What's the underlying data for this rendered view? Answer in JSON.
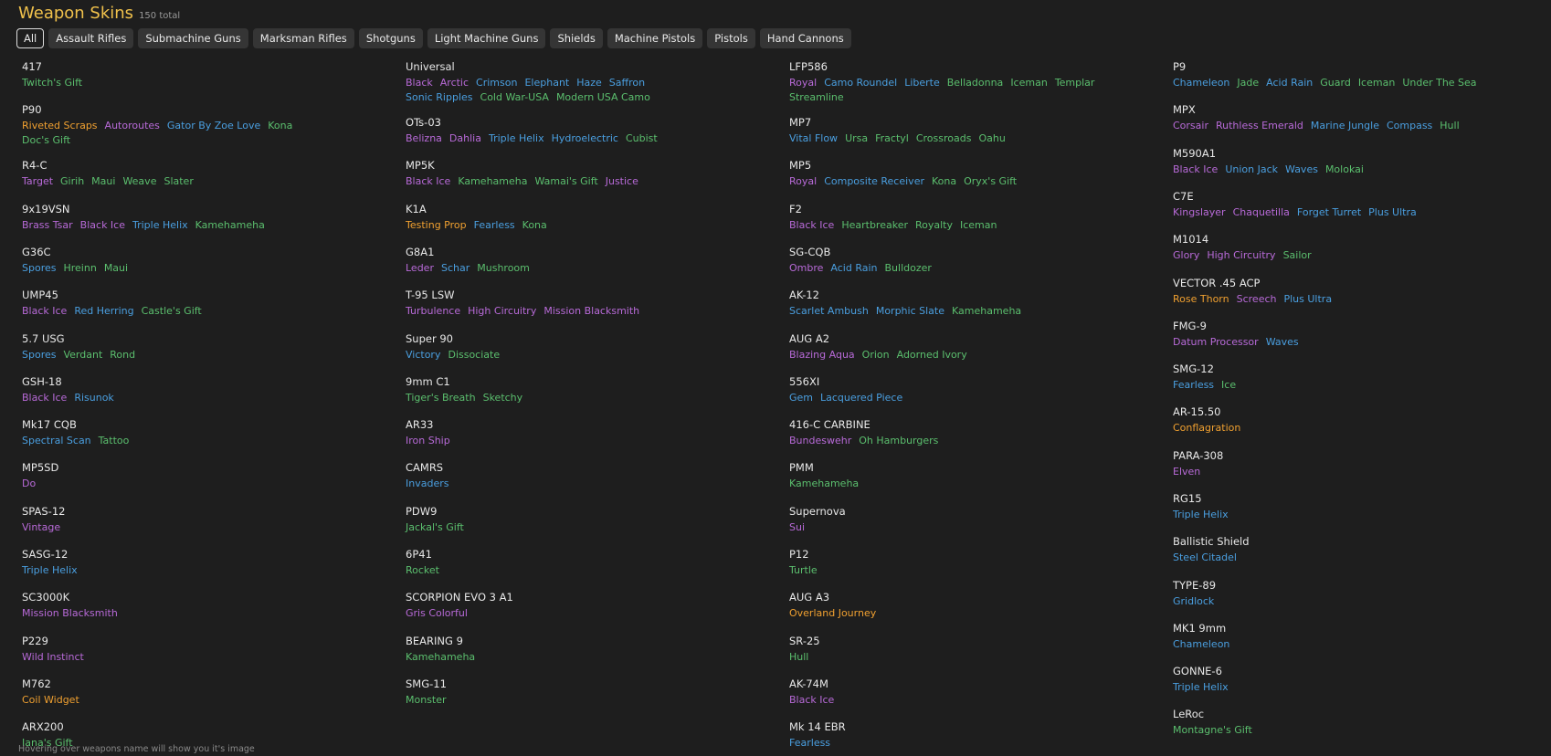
{
  "header": {
    "title": "Weapon Skins",
    "total": "150 total"
  },
  "filters": [
    "All",
    "Assault Rifles",
    "Submachine Guns",
    "Marksman Rifles",
    "Shotguns",
    "Light Machine Guns",
    "Shields",
    "Machine Pistols",
    "Pistols",
    "Hand Cannons"
  ],
  "colors": {
    "green": "#5bbf6e",
    "purple": "#b86ad8",
    "blue": "#4a9fe0",
    "orange": "#f0a030",
    "title": "#f0c14b"
  },
  "columns": [
    [
      {
        "name": "417",
        "skins": [
          {
            "n": "Twitch's Gift",
            "c": "green"
          }
        ]
      },
      {
        "name": "P90",
        "skins": [
          {
            "n": "Riveted Scraps",
            "c": "orange"
          },
          {
            "n": "Autoroutes",
            "c": "purple"
          },
          {
            "n": "Gator By Zoe Love",
            "c": "blue"
          },
          {
            "n": "Kona",
            "c": "green"
          },
          {
            "n": "Doc's Gift",
            "c": "green"
          }
        ]
      },
      {
        "name": "R4-C",
        "skins": [
          {
            "n": "Target",
            "c": "purple"
          },
          {
            "n": "Girih",
            "c": "green"
          },
          {
            "n": "Maui",
            "c": "green"
          },
          {
            "n": "Weave",
            "c": "green"
          },
          {
            "n": "Slater",
            "c": "green"
          }
        ]
      },
      {
        "name": "9x19VSN",
        "skins": [
          {
            "n": "Brass Tsar",
            "c": "purple"
          },
          {
            "n": "Black Ice",
            "c": "purple"
          },
          {
            "n": "Triple Helix",
            "c": "blue"
          },
          {
            "n": "Kamehameha",
            "c": "green"
          }
        ]
      },
      {
        "name": "G36C",
        "skins": [
          {
            "n": "Spores",
            "c": "blue"
          },
          {
            "n": "Hreinn",
            "c": "green"
          },
          {
            "n": "Maui",
            "c": "green"
          }
        ]
      },
      {
        "name": "UMP45",
        "skins": [
          {
            "n": "Black Ice",
            "c": "purple"
          },
          {
            "n": "Red Herring",
            "c": "blue"
          },
          {
            "n": "Castle's Gift",
            "c": "green"
          }
        ]
      },
      {
        "name": "5.7 USG",
        "skins": [
          {
            "n": "Spores",
            "c": "blue"
          },
          {
            "n": "Verdant",
            "c": "green"
          },
          {
            "n": "Rond",
            "c": "green"
          }
        ]
      },
      {
        "name": "GSH-18",
        "skins": [
          {
            "n": "Black Ice",
            "c": "purple"
          },
          {
            "n": "Risunok",
            "c": "blue"
          }
        ]
      },
      {
        "name": "Mk17 CQB",
        "skins": [
          {
            "n": "Spectral Scan",
            "c": "blue"
          },
          {
            "n": "Tattoo",
            "c": "green"
          }
        ]
      },
      {
        "name": "MP5SD",
        "skins": [
          {
            "n": "Do",
            "c": "purple"
          }
        ]
      },
      {
        "name": "SPAS-12",
        "skins": [
          {
            "n": "Vintage",
            "c": "purple"
          }
        ]
      },
      {
        "name": "SASG-12",
        "skins": [
          {
            "n": "Triple Helix",
            "c": "blue"
          }
        ]
      },
      {
        "name": "SC3000K",
        "skins": [
          {
            "n": "Mission Blacksmith",
            "c": "purple"
          }
        ]
      },
      {
        "name": "P229",
        "skins": [
          {
            "n": "Wild Instinct",
            "c": "purple"
          }
        ]
      },
      {
        "name": "M762",
        "skins": [
          {
            "n": "Coil Widget",
            "c": "orange"
          }
        ]
      },
      {
        "name": "ARX200",
        "skins": [
          {
            "n": "Iana's Gift",
            "c": "green"
          }
        ]
      }
    ],
    [
      {
        "name": "Universal",
        "skins": [
          {
            "n": "Black",
            "c": "purple"
          },
          {
            "n": "Arctic",
            "c": "purple"
          },
          {
            "n": "Crimson",
            "c": "blue"
          },
          {
            "n": "Elephant",
            "c": "blue"
          },
          {
            "n": "Haze",
            "c": "blue"
          },
          {
            "n": "Saffron",
            "c": "blue"
          },
          {
            "n": "Sonic Ripples",
            "c": "blue"
          },
          {
            "n": "Cold War-USA",
            "c": "green"
          },
          {
            "n": "Modern USA Camo",
            "c": "green"
          }
        ]
      },
      {
        "name": "OTs-03",
        "skins": [
          {
            "n": "Belizna",
            "c": "purple"
          },
          {
            "n": "Dahlia",
            "c": "purple"
          },
          {
            "n": "Triple Helix",
            "c": "blue"
          },
          {
            "n": "Hydroelectric",
            "c": "blue"
          },
          {
            "n": "Cubist",
            "c": "green"
          }
        ]
      },
      {
        "name": "MP5K",
        "skins": [
          {
            "n": "Black Ice",
            "c": "purple"
          },
          {
            "n": "Kamehameha",
            "c": "green"
          },
          {
            "n": "Wamai's Gift",
            "c": "green"
          },
          {
            "n": "Justice",
            "c": "purple"
          }
        ]
      },
      {
        "name": "K1A",
        "skins": [
          {
            "n": "Testing Prop",
            "c": "orange"
          },
          {
            "n": "Fearless",
            "c": "blue"
          },
          {
            "n": "Kona",
            "c": "green"
          }
        ]
      },
      {
        "name": "G8A1",
        "skins": [
          {
            "n": "Leder",
            "c": "purple"
          },
          {
            "n": "Schar",
            "c": "blue"
          },
          {
            "n": "Mushroom",
            "c": "green"
          }
        ]
      },
      {
        "name": "T-95 LSW",
        "skins": [
          {
            "n": "Turbulence",
            "c": "purple"
          },
          {
            "n": "High Circuitry",
            "c": "purple"
          },
          {
            "n": "Mission Blacksmith",
            "c": "purple"
          }
        ]
      },
      {
        "name": "Super 90",
        "skins": [
          {
            "n": "Victory",
            "c": "blue"
          },
          {
            "n": "Dissociate",
            "c": "green"
          }
        ]
      },
      {
        "name": "9mm C1",
        "skins": [
          {
            "n": "Tiger's Breath",
            "c": "green"
          },
          {
            "n": "Sketchy",
            "c": "green"
          }
        ]
      },
      {
        "name": "AR33",
        "skins": [
          {
            "n": "Iron Ship",
            "c": "purple"
          }
        ]
      },
      {
        "name": "CAMRS",
        "skins": [
          {
            "n": "Invaders",
            "c": "blue"
          }
        ]
      },
      {
        "name": "PDW9",
        "skins": [
          {
            "n": "Jackal's Gift",
            "c": "green"
          }
        ]
      },
      {
        "name": "6P41",
        "skins": [
          {
            "n": "Rocket",
            "c": "green"
          }
        ]
      },
      {
        "name": "SCORPION EVO 3 A1",
        "skins": [
          {
            "n": "Gris Colorful",
            "c": "purple"
          }
        ]
      },
      {
        "name": "BEARING 9",
        "skins": [
          {
            "n": "Kamehameha",
            "c": "green"
          }
        ]
      },
      {
        "name": "SMG-11",
        "skins": [
          {
            "n": "Monster",
            "c": "green"
          }
        ]
      }
    ],
    [
      {
        "name": "LFP586",
        "skins": [
          {
            "n": "Royal",
            "c": "purple"
          },
          {
            "n": "Camo Roundel",
            "c": "blue"
          },
          {
            "n": "Liberte",
            "c": "blue"
          },
          {
            "n": "Belladonna",
            "c": "green"
          },
          {
            "n": "Iceman",
            "c": "green"
          },
          {
            "n": "Templar",
            "c": "green"
          },
          {
            "n": "Streamline",
            "c": "green"
          }
        ]
      },
      {
        "name": "MP7",
        "skins": [
          {
            "n": "Vital Flow",
            "c": "blue"
          },
          {
            "n": "Ursa",
            "c": "green"
          },
          {
            "n": "Fractyl",
            "c": "green"
          },
          {
            "n": "Crossroads",
            "c": "green"
          },
          {
            "n": "Oahu",
            "c": "green"
          }
        ]
      },
      {
        "name": "MP5",
        "skins": [
          {
            "n": "Royal",
            "c": "purple"
          },
          {
            "n": "Composite Receiver",
            "c": "blue"
          },
          {
            "n": "Kona",
            "c": "green"
          },
          {
            "n": "Oryx's Gift",
            "c": "green"
          }
        ]
      },
      {
        "name": "F2",
        "skins": [
          {
            "n": "Black Ice",
            "c": "purple"
          },
          {
            "n": "Heartbreaker",
            "c": "green"
          },
          {
            "n": "Royalty",
            "c": "green"
          },
          {
            "n": "Iceman",
            "c": "green"
          }
        ]
      },
      {
        "name": "SG-CQB",
        "skins": [
          {
            "n": "Ombre",
            "c": "purple"
          },
          {
            "n": "Acid Rain",
            "c": "blue"
          },
          {
            "n": "Bulldozer",
            "c": "green"
          }
        ]
      },
      {
        "name": "AK-12",
        "skins": [
          {
            "n": "Scarlet Ambush",
            "c": "blue"
          },
          {
            "n": "Morphic Slate",
            "c": "blue"
          },
          {
            "n": "Kamehameha",
            "c": "green"
          }
        ]
      },
      {
        "name": "AUG A2",
        "skins": [
          {
            "n": "Blazing Aqua",
            "c": "purple"
          },
          {
            "n": "Orion",
            "c": "green"
          },
          {
            "n": "Adorned Ivory",
            "c": "green"
          }
        ]
      },
      {
        "name": "556XI",
        "skins": [
          {
            "n": "Gem",
            "c": "blue"
          },
          {
            "n": "Lacquered Piece",
            "c": "blue"
          }
        ]
      },
      {
        "name": "416-C CARBINE",
        "skins": [
          {
            "n": "Bundeswehr",
            "c": "purple"
          },
          {
            "n": "Oh Hamburgers",
            "c": "green"
          }
        ]
      },
      {
        "name": "PMM",
        "skins": [
          {
            "n": "Kamehameha",
            "c": "green"
          }
        ]
      },
      {
        "name": "Supernova",
        "skins": [
          {
            "n": "Sui",
            "c": "purple"
          }
        ]
      },
      {
        "name": "P12",
        "skins": [
          {
            "n": "Turtle",
            "c": "green"
          }
        ]
      },
      {
        "name": "AUG A3",
        "skins": [
          {
            "n": "Overland Journey",
            "c": "orange"
          }
        ]
      },
      {
        "name": "SR-25",
        "skins": [
          {
            "n": "Hull",
            "c": "green"
          }
        ]
      },
      {
        "name": "AK-74M",
        "skins": [
          {
            "n": "Black Ice",
            "c": "purple"
          }
        ]
      },
      {
        "name": "Mk 14 EBR",
        "skins": [
          {
            "n": "Fearless",
            "c": "blue"
          }
        ]
      }
    ],
    [
      {
        "name": "P9",
        "skins": [
          {
            "n": "Chameleon",
            "c": "blue"
          },
          {
            "n": "Jade",
            "c": "green"
          },
          {
            "n": "Acid Rain",
            "c": "blue"
          },
          {
            "n": "Guard",
            "c": "green"
          },
          {
            "n": "Iceman",
            "c": "green"
          },
          {
            "n": "Under The Sea",
            "c": "green"
          }
        ]
      },
      {
        "name": "MPX",
        "skins": [
          {
            "n": "Corsair",
            "c": "purple"
          },
          {
            "n": "Ruthless Emerald",
            "c": "purple"
          },
          {
            "n": "Marine Jungle",
            "c": "blue"
          },
          {
            "n": "Compass",
            "c": "blue"
          },
          {
            "n": "Hull",
            "c": "green"
          }
        ]
      },
      {
        "name": "M590A1",
        "skins": [
          {
            "n": "Black Ice",
            "c": "purple"
          },
          {
            "n": "Union Jack",
            "c": "blue"
          },
          {
            "n": "Waves",
            "c": "blue"
          },
          {
            "n": "Molokai",
            "c": "green"
          }
        ]
      },
      {
        "name": "C7E",
        "skins": [
          {
            "n": "Kingslayer",
            "c": "purple"
          },
          {
            "n": "Chaquetilla",
            "c": "purple"
          },
          {
            "n": "Forget Turret",
            "c": "blue"
          },
          {
            "n": "Plus Ultra",
            "c": "blue"
          }
        ]
      },
      {
        "name": "M1014",
        "skins": [
          {
            "n": "Glory",
            "c": "purple"
          },
          {
            "n": "High Circuitry",
            "c": "purple"
          },
          {
            "n": "Sailor",
            "c": "green"
          }
        ]
      },
      {
        "name": "VECTOR .45 ACP",
        "skins": [
          {
            "n": "Rose Thorn",
            "c": "orange"
          },
          {
            "n": "Screech",
            "c": "purple"
          },
          {
            "n": "Plus Ultra",
            "c": "blue"
          }
        ]
      },
      {
        "name": "FMG-9",
        "skins": [
          {
            "n": "Datum Processor",
            "c": "purple"
          },
          {
            "n": "Waves",
            "c": "blue"
          }
        ]
      },
      {
        "name": "SMG-12",
        "skins": [
          {
            "n": "Fearless",
            "c": "blue"
          },
          {
            "n": "Ice",
            "c": "green"
          }
        ]
      },
      {
        "name": "AR-15.50",
        "skins": [
          {
            "n": "Conflagration",
            "c": "orange"
          }
        ]
      },
      {
        "name": "PARA-308",
        "skins": [
          {
            "n": "Elven",
            "c": "purple"
          }
        ]
      },
      {
        "name": "RG15",
        "skins": [
          {
            "n": "Triple Helix",
            "c": "blue"
          }
        ]
      },
      {
        "name": "Ballistic Shield",
        "skins": [
          {
            "n": "Steel Citadel",
            "c": "blue"
          }
        ]
      },
      {
        "name": "TYPE-89",
        "skins": [
          {
            "n": "Gridlock",
            "c": "blue"
          }
        ]
      },
      {
        "name": "MK1 9mm",
        "skins": [
          {
            "n": "Chameleon",
            "c": "blue"
          }
        ]
      },
      {
        "name": "GONNE-6",
        "skins": [
          {
            "n": "Triple Helix",
            "c": "blue"
          }
        ]
      },
      {
        "name": "LeRoc",
        "skins": [
          {
            "n": "Montagne's Gift",
            "c": "green"
          }
        ]
      }
    ]
  ],
  "footer": "Hovering over weapons name will show you it's image"
}
